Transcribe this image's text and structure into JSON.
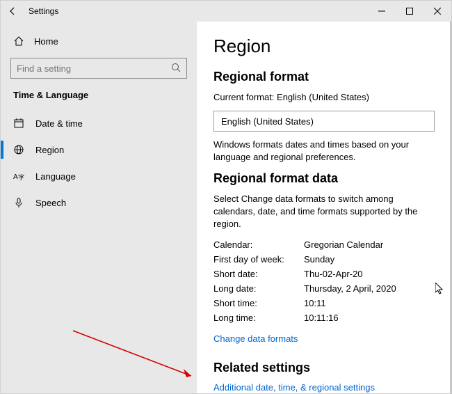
{
  "titlebar": {
    "title": "Settings"
  },
  "sidebar": {
    "home": "Home",
    "search_placeholder": "Find a setting",
    "heading": "Time & Language",
    "items": [
      {
        "label": "Date & time"
      },
      {
        "label": "Region"
      },
      {
        "label": "Language"
      },
      {
        "label": "Speech"
      }
    ]
  },
  "main": {
    "title": "Region",
    "regional_format": {
      "heading": "Regional format",
      "current_label": "Current format: English (United States)",
      "dropdown_value": "English (United States)",
      "description": "Windows formats dates and times based on your language and regional preferences."
    },
    "format_data": {
      "heading": "Regional format data",
      "description": "Select Change data formats to switch among calendars, date, and time formats supported by the region.",
      "rows": [
        {
          "label": "Calendar:",
          "value": "Gregorian Calendar"
        },
        {
          "label": "First day of week:",
          "value": "Sunday"
        },
        {
          "label": "Short date:",
          "value": "Thu-02-Apr-20"
        },
        {
          "label": "Long date:",
          "value": "Thursday, 2 April, 2020"
        },
        {
          "label": "Short time:",
          "value": "10:11"
        },
        {
          "label": "Long time:",
          "value": "10:11:16"
        }
      ],
      "change_link": "Change data formats"
    },
    "related": {
      "heading": "Related settings",
      "link": "Additional date, time, & regional settings"
    }
  }
}
